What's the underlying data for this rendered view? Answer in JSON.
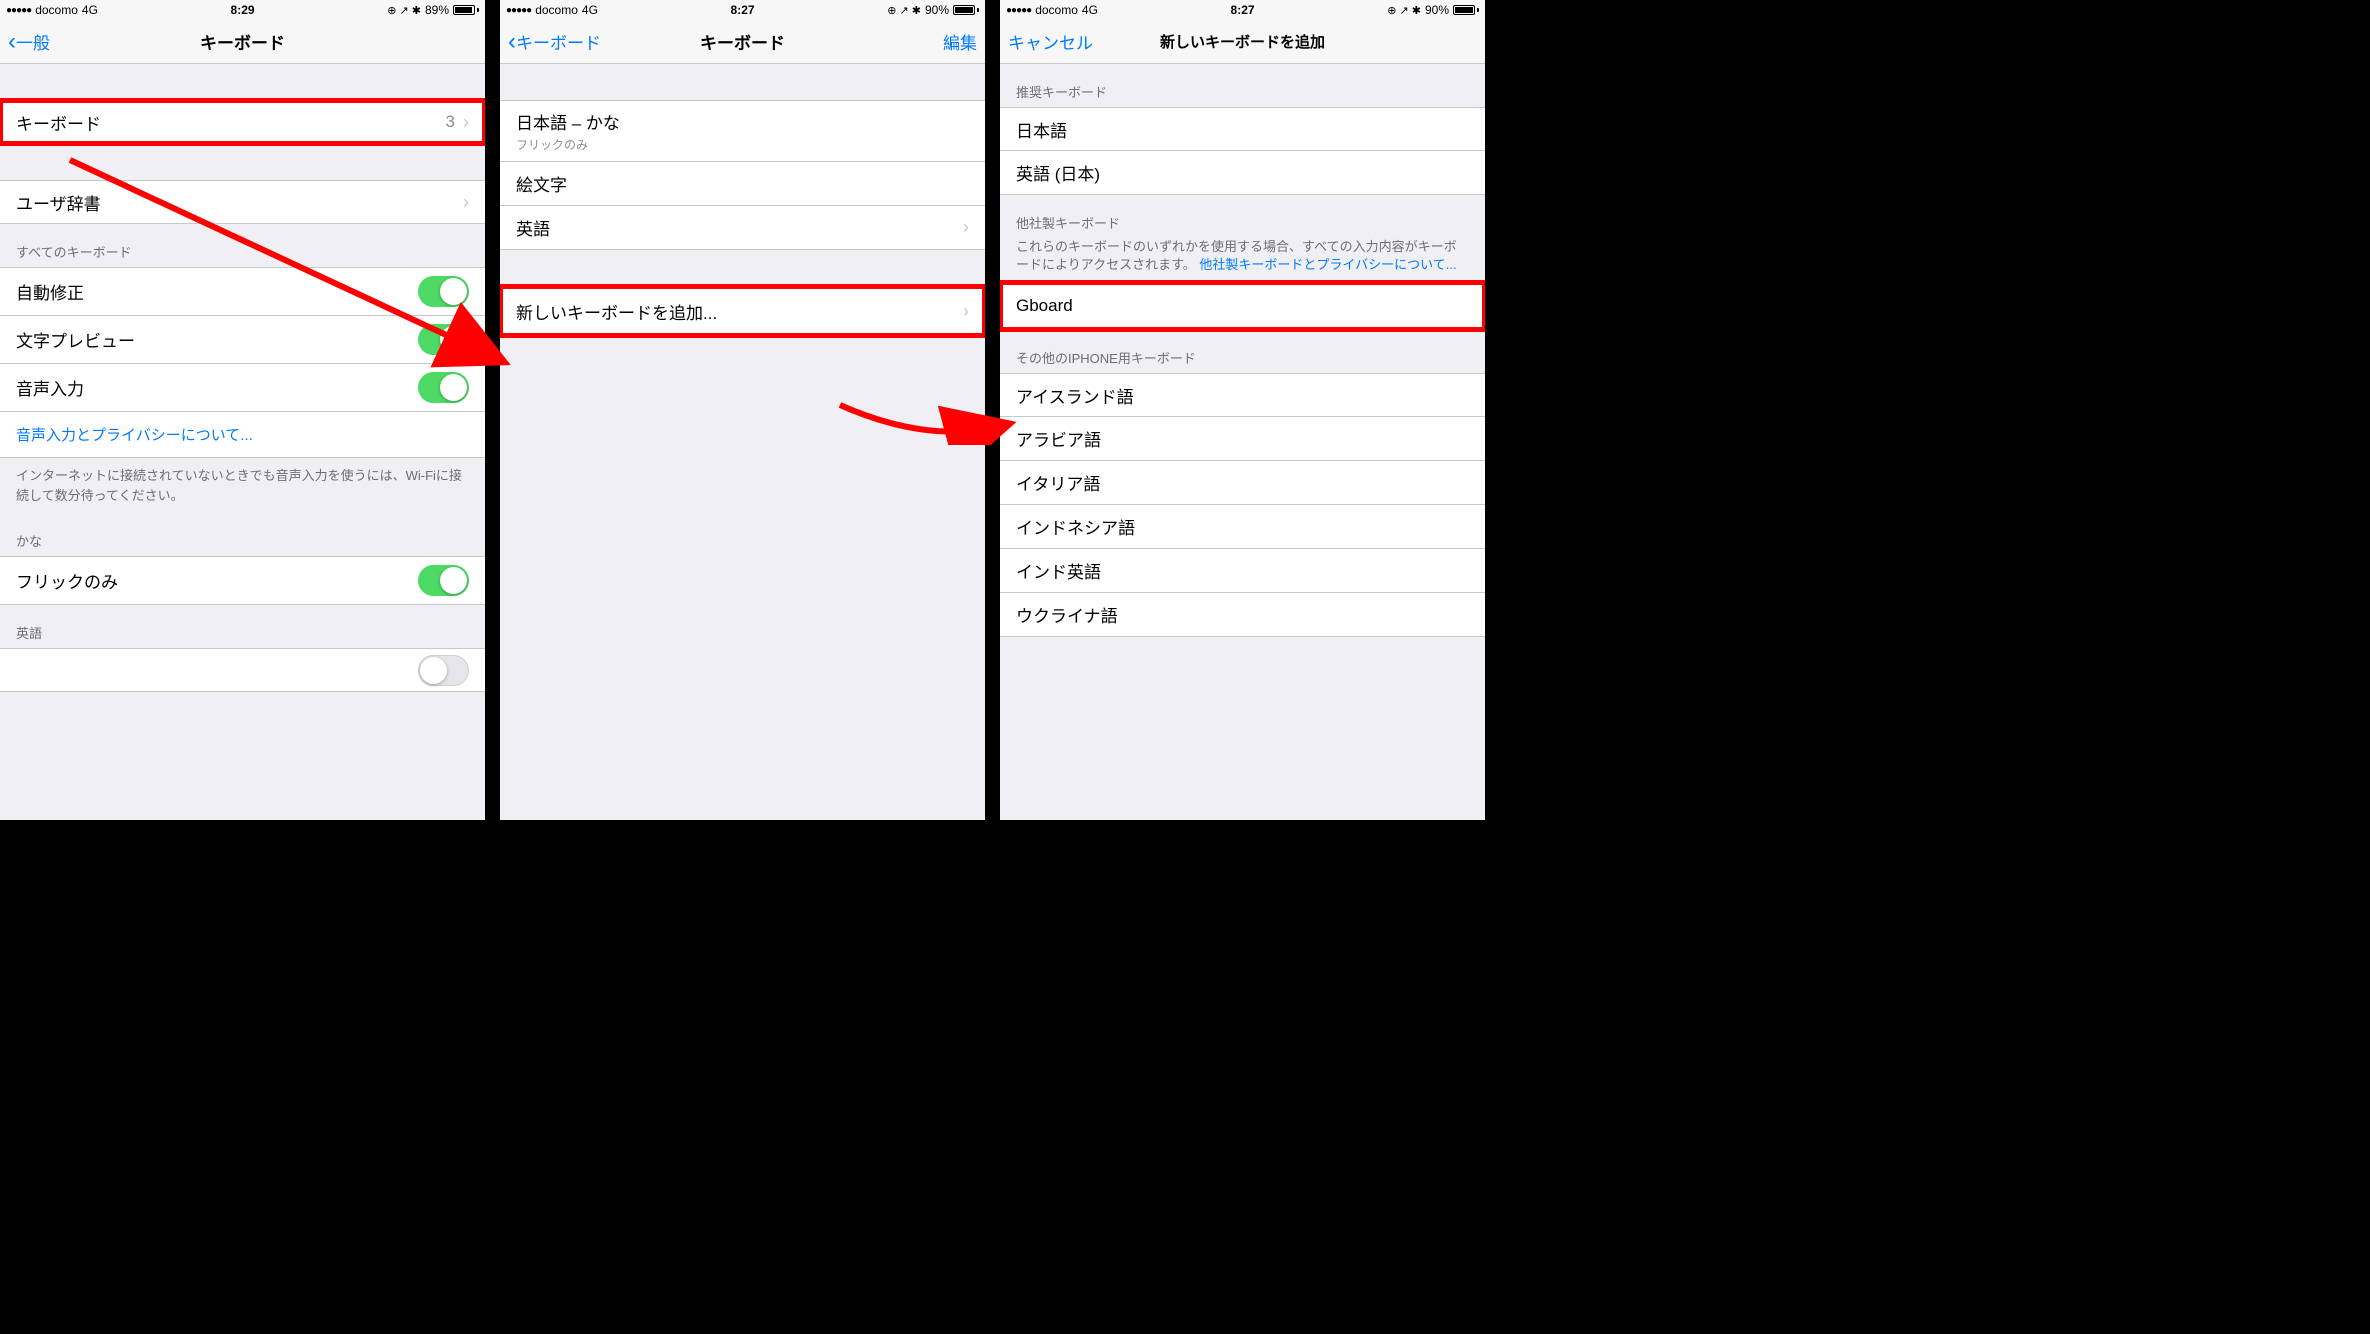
{
  "status": {
    "carrier": "docomo",
    "network": "4G",
    "icons": "⨀ ↗ ⚲"
  },
  "screen1": {
    "time": "8:29",
    "battery": "89%",
    "back": "一般",
    "title": "キーボード",
    "cells": {
      "keyboards": "キーボード",
      "keyboards_count": "3",
      "user_dict": "ユーザ辞書"
    },
    "header_all": "すべてのキーボード",
    "toggles": {
      "auto_correct": "自動修正",
      "char_preview": "文字プレビュー",
      "dictation": "音声入力"
    },
    "dictation_link": "音声入力とプライバシーについて...",
    "dictation_footer": "インターネットに接続されていないときでも音声入力を使うには、Wi-Fiに接続して数分待ってください。",
    "header_kana": "かな",
    "flick_only": "フリックのみ",
    "header_english": "英語"
  },
  "screen2": {
    "time": "8:27",
    "battery": "90%",
    "back": "キーボード",
    "title": "キーボード",
    "edit": "編集",
    "kb_jp": "日本語 – かな",
    "kb_jp_sub": "フリックのみ",
    "kb_emoji": "絵文字",
    "kb_en": "英語",
    "add_new": "新しいキーボードを追加..."
  },
  "screen3": {
    "time": "8:27",
    "battery": "90%",
    "cancel": "キャンセル",
    "title": "新しいキーボードを追加",
    "header_recommended": "推奨キーボード",
    "rec_jp": "日本語",
    "rec_en": "英語 (日本)",
    "header_thirdparty": "他社製キーボード",
    "thirdparty_footer": "これらのキーボードのいずれかを使用する場合、すべての入力内容がキーボードによりアクセスされます。",
    "thirdparty_link": "他社製キーボードとプライバシーについて...",
    "gboard": "Gboard",
    "header_other": "その他のIPHONE用キーボード",
    "other": {
      "iceland": "アイスランド語",
      "arabic": "アラビア語",
      "italian": "イタリア語",
      "indonesian": "インドネシア語",
      "hindi_en": "インド英語",
      "ukrainian": "ウクライナ語"
    }
  }
}
